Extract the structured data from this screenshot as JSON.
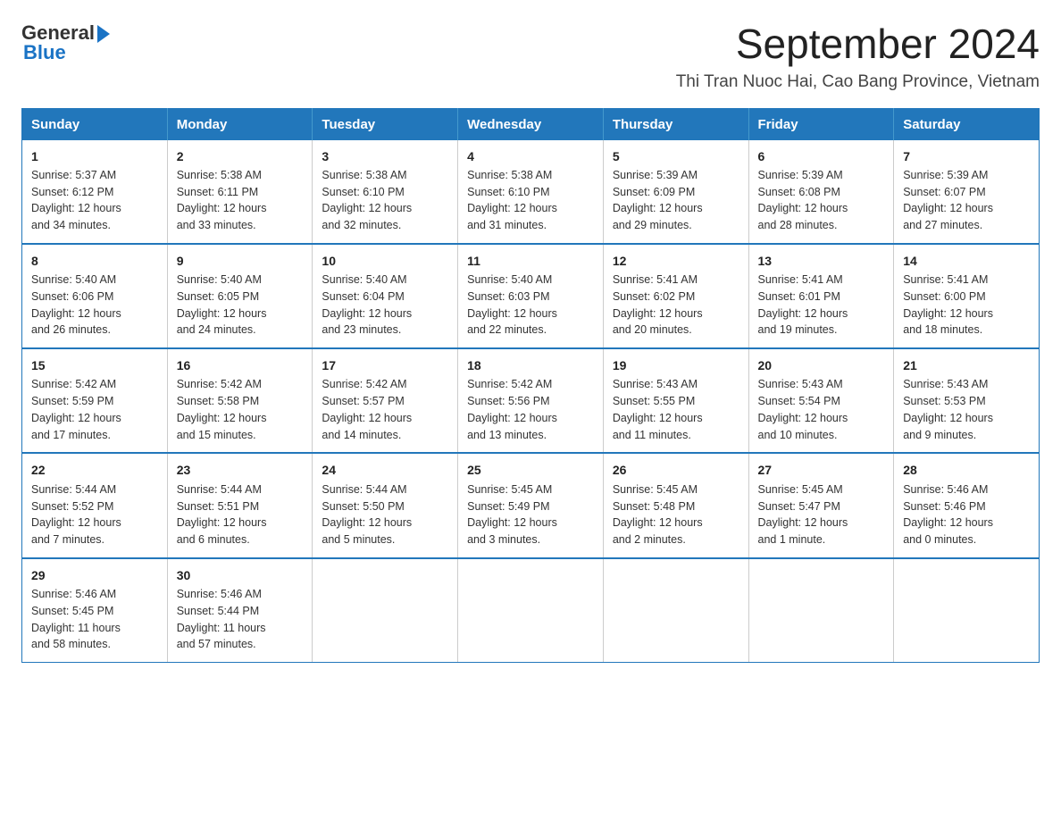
{
  "header": {
    "logo_general": "General",
    "logo_blue": "Blue",
    "month_title": "September 2024",
    "location": "Thi Tran Nuoc Hai, Cao Bang Province, Vietnam"
  },
  "days_of_week": [
    "Sunday",
    "Monday",
    "Tuesday",
    "Wednesday",
    "Thursday",
    "Friday",
    "Saturday"
  ],
  "weeks": [
    [
      {
        "day": "1",
        "info": "Sunrise: 5:37 AM\nSunset: 6:12 PM\nDaylight: 12 hours\nand 34 minutes."
      },
      {
        "day": "2",
        "info": "Sunrise: 5:38 AM\nSunset: 6:11 PM\nDaylight: 12 hours\nand 33 minutes."
      },
      {
        "day": "3",
        "info": "Sunrise: 5:38 AM\nSunset: 6:10 PM\nDaylight: 12 hours\nand 32 minutes."
      },
      {
        "day": "4",
        "info": "Sunrise: 5:38 AM\nSunset: 6:10 PM\nDaylight: 12 hours\nand 31 minutes."
      },
      {
        "day": "5",
        "info": "Sunrise: 5:39 AM\nSunset: 6:09 PM\nDaylight: 12 hours\nand 29 minutes."
      },
      {
        "day": "6",
        "info": "Sunrise: 5:39 AM\nSunset: 6:08 PM\nDaylight: 12 hours\nand 28 minutes."
      },
      {
        "day": "7",
        "info": "Sunrise: 5:39 AM\nSunset: 6:07 PM\nDaylight: 12 hours\nand 27 minutes."
      }
    ],
    [
      {
        "day": "8",
        "info": "Sunrise: 5:40 AM\nSunset: 6:06 PM\nDaylight: 12 hours\nand 26 minutes."
      },
      {
        "day": "9",
        "info": "Sunrise: 5:40 AM\nSunset: 6:05 PM\nDaylight: 12 hours\nand 24 minutes."
      },
      {
        "day": "10",
        "info": "Sunrise: 5:40 AM\nSunset: 6:04 PM\nDaylight: 12 hours\nand 23 minutes."
      },
      {
        "day": "11",
        "info": "Sunrise: 5:40 AM\nSunset: 6:03 PM\nDaylight: 12 hours\nand 22 minutes."
      },
      {
        "day": "12",
        "info": "Sunrise: 5:41 AM\nSunset: 6:02 PM\nDaylight: 12 hours\nand 20 minutes."
      },
      {
        "day": "13",
        "info": "Sunrise: 5:41 AM\nSunset: 6:01 PM\nDaylight: 12 hours\nand 19 minutes."
      },
      {
        "day": "14",
        "info": "Sunrise: 5:41 AM\nSunset: 6:00 PM\nDaylight: 12 hours\nand 18 minutes."
      }
    ],
    [
      {
        "day": "15",
        "info": "Sunrise: 5:42 AM\nSunset: 5:59 PM\nDaylight: 12 hours\nand 17 minutes."
      },
      {
        "day": "16",
        "info": "Sunrise: 5:42 AM\nSunset: 5:58 PM\nDaylight: 12 hours\nand 15 minutes."
      },
      {
        "day": "17",
        "info": "Sunrise: 5:42 AM\nSunset: 5:57 PM\nDaylight: 12 hours\nand 14 minutes."
      },
      {
        "day": "18",
        "info": "Sunrise: 5:42 AM\nSunset: 5:56 PM\nDaylight: 12 hours\nand 13 minutes."
      },
      {
        "day": "19",
        "info": "Sunrise: 5:43 AM\nSunset: 5:55 PM\nDaylight: 12 hours\nand 11 minutes."
      },
      {
        "day": "20",
        "info": "Sunrise: 5:43 AM\nSunset: 5:54 PM\nDaylight: 12 hours\nand 10 minutes."
      },
      {
        "day": "21",
        "info": "Sunrise: 5:43 AM\nSunset: 5:53 PM\nDaylight: 12 hours\nand 9 minutes."
      }
    ],
    [
      {
        "day": "22",
        "info": "Sunrise: 5:44 AM\nSunset: 5:52 PM\nDaylight: 12 hours\nand 7 minutes."
      },
      {
        "day": "23",
        "info": "Sunrise: 5:44 AM\nSunset: 5:51 PM\nDaylight: 12 hours\nand 6 minutes."
      },
      {
        "day": "24",
        "info": "Sunrise: 5:44 AM\nSunset: 5:50 PM\nDaylight: 12 hours\nand 5 minutes."
      },
      {
        "day": "25",
        "info": "Sunrise: 5:45 AM\nSunset: 5:49 PM\nDaylight: 12 hours\nand 3 minutes."
      },
      {
        "day": "26",
        "info": "Sunrise: 5:45 AM\nSunset: 5:48 PM\nDaylight: 12 hours\nand 2 minutes."
      },
      {
        "day": "27",
        "info": "Sunrise: 5:45 AM\nSunset: 5:47 PM\nDaylight: 12 hours\nand 1 minute."
      },
      {
        "day": "28",
        "info": "Sunrise: 5:46 AM\nSunset: 5:46 PM\nDaylight: 12 hours\nand 0 minutes."
      }
    ],
    [
      {
        "day": "29",
        "info": "Sunrise: 5:46 AM\nSunset: 5:45 PM\nDaylight: 11 hours\nand 58 minutes."
      },
      {
        "day": "30",
        "info": "Sunrise: 5:46 AM\nSunset: 5:44 PM\nDaylight: 11 hours\nand 57 minutes."
      },
      {
        "day": "",
        "info": ""
      },
      {
        "day": "",
        "info": ""
      },
      {
        "day": "",
        "info": ""
      },
      {
        "day": "",
        "info": ""
      },
      {
        "day": "",
        "info": ""
      }
    ]
  ]
}
